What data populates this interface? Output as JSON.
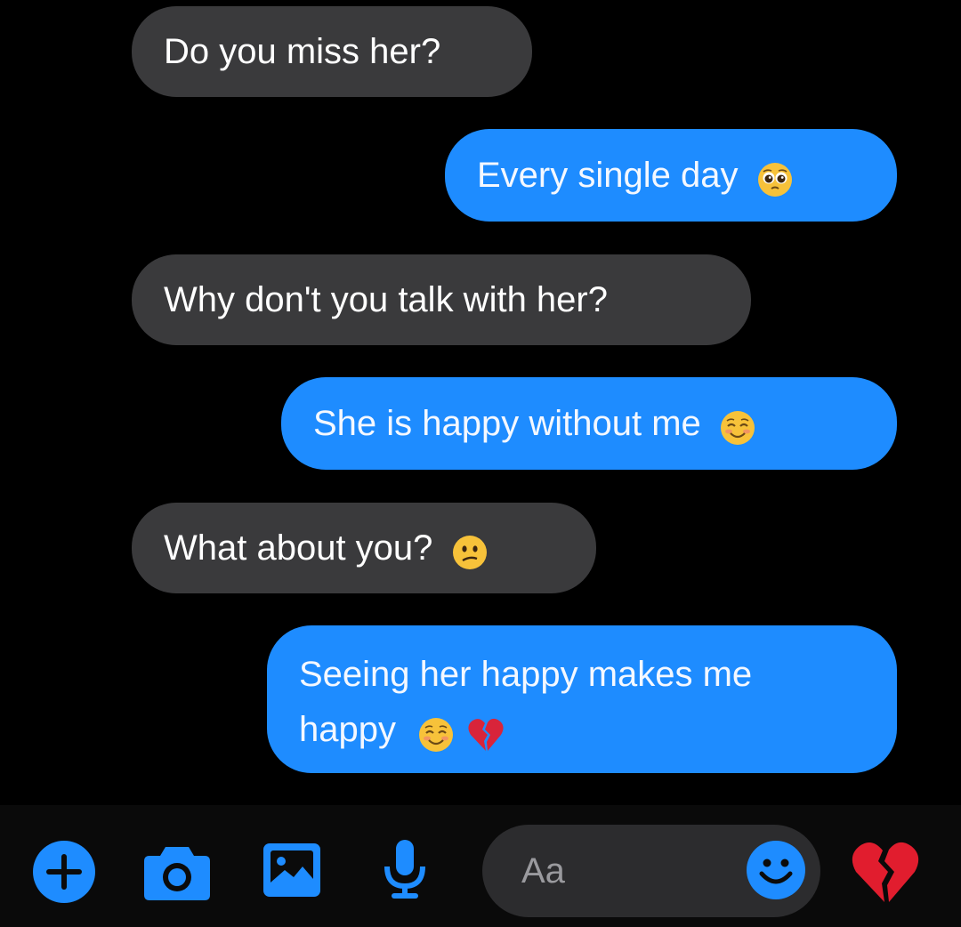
{
  "messages": [
    {
      "direction": "incoming",
      "text": "Do you miss her?",
      "emoji": []
    },
    {
      "direction": "outgoing",
      "text": "Every single day",
      "emoji": [
        "pleading-face"
      ]
    },
    {
      "direction": "incoming",
      "text": "Why don't you talk with her?",
      "emoji": []
    },
    {
      "direction": "outgoing",
      "text": "She is happy without me",
      "emoji": [
        "smiling-face"
      ]
    },
    {
      "direction": "incoming",
      "text": "What about you?",
      "emoji": [
        "confused-face"
      ]
    },
    {
      "direction": "outgoing",
      "line1": "Seeing her happy makes me",
      "line2": "happy",
      "emoji": [
        "smiling-face",
        "broken-heart"
      ]
    }
  ],
  "composer": {
    "placeholder": "Aa",
    "tools": [
      "plus-icon",
      "camera-icon",
      "image-icon",
      "microphone-icon"
    ],
    "emoji_button": "smiley-icon",
    "quick_reaction": "broken-heart"
  },
  "colors": {
    "background": "#000000",
    "incoming_bubble": "#3a3a3c",
    "outgoing_bubble": "#1e8cff",
    "accent": "#1e8cff",
    "input_pill": "#2c2c2e"
  }
}
